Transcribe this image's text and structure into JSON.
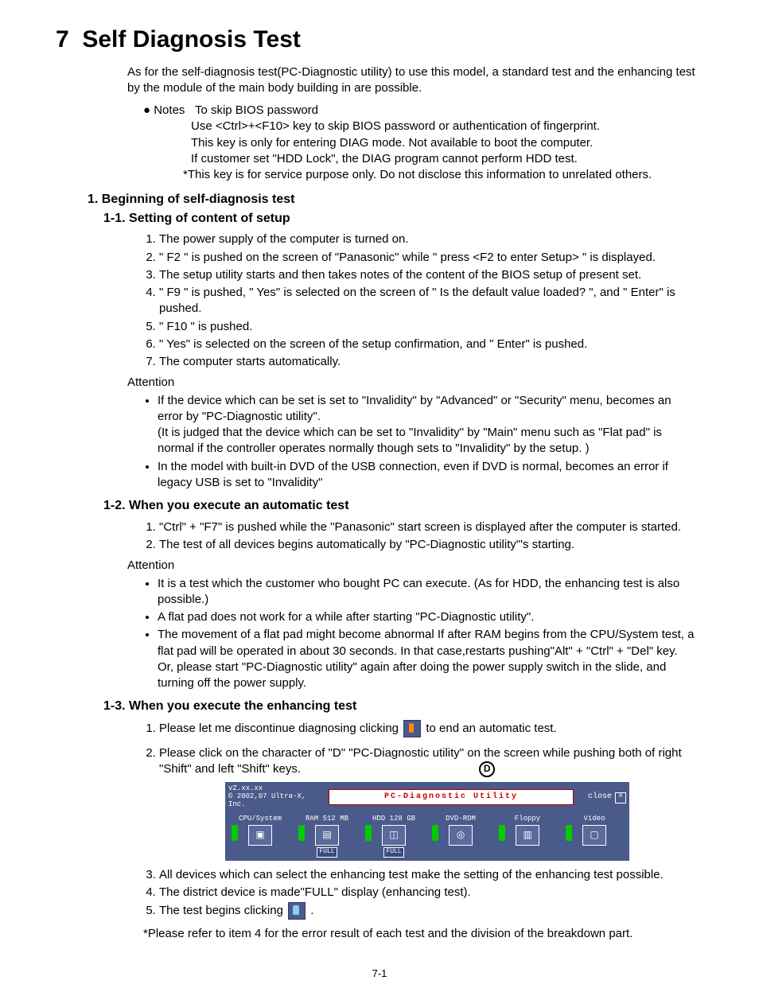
{
  "chapter_num": "7",
  "chapter_title": "Self Diagnosis Test",
  "intro": "As for the self-diagnosis test(PC-Diagnostic utility) to use this model, a standard test and the enhancing test by the module of the main body building in are possible.",
  "notes_label": "● Notes",
  "notes_title": "To skip BIOS password",
  "notes_lines": [
    "Use <Ctrl>+<F10> key to skip BIOS password or authentication of fingerprint.",
    "This key is only for entering DIAG mode. Not available to boot the computer.",
    "If customer set \"HDD Lock\",  the DIAG program cannot perform HDD test.",
    "*This key is for service purpose only. Do not disclose this information to unrelated others."
  ],
  "h_1": "1. Beginning of self-diagnosis test",
  "h_1_1": "1-1. Setting of content of setup",
  "steps_1_1": [
    "The power supply of the computer is turned on.",
    "\" F2 \" is pushed on the screen of  \"Panasonic\" while \" press <F2 to enter Setup> \" is displayed.",
    "The setup utility starts and then takes notes of the content of the BIOS setup of present set.",
    "\" F9 \" is pushed, \" Yes\" is selected on the screen of \" Is the default value loaded? \", and \" Enter\" is pushed.",
    "\" F10 \" is pushed.",
    "\" Yes\" is selected on the screen of the setup confirmation, and \" Enter\" is pushed.",
    "The computer starts automatically."
  ],
  "attention_label": "Attention",
  "attn_1_1": [
    "If the device which can be set is set to \"Invalidity\" by \"Advanced\" or \"Security\" menu, becomes an error by \"PC-Diagnostic utility\".\n(It is judged that the device which can be set to \"Invalidity\" by \"Main\" menu such as \"Flat pad\" is normal if the controller operates normally though sets to \"Invalidity\" by the setup. )",
    "In the model with built-in DVD of the USB connection, even if DVD is normal, becomes an error if legacy USB is set to \"Invalidity\""
  ],
  "h_1_2": "1-2. When you execute an automatic test",
  "steps_1_2": [
    "\"Ctrl\" + \"F7\" is pushed while the \"Panasonic\" start screen is displayed after the computer is started.",
    "The test of all devices begins automatically by \"PC-Diagnostic utility\"'s starting."
  ],
  "attn_1_2": [
    "It is a test which the customer who bought PC can execute. (As for HDD, the enhancing test is also possible.)",
    "A flat pad does not work for a while after starting \"PC-Diagnostic utility\".",
    "The movement of a flat pad might become abnormal If after RAM begins from the CPU/System test, a flat pad will be operated in about 30 seconds. In that case,restarts pushing\"Alt\" + \"Ctrl\" + \"Del\" key. Or, please start \"PC-Diagnostic utility\" again after doing the power supply switch in the slide, and turning off the power supply."
  ],
  "h_1_3": "1-3. When you execute the enhancing test",
  "step_1_3_1a": "Please let me discontinue diagnosing clicking",
  "step_1_3_1b": "to end an automatic test.",
  "step_1_3_2": "Please click on the character of \"D\" \"PC-Diagnostic utility\" on the screen while pushing both of right \"Shift\" and left \"Shift\" keys.",
  "d_marker": "D",
  "diag": {
    "version": "vZ.xx.xx",
    "copyright": "© 2002,07 Ultra-X, Inc.",
    "title": "PC-Diagnostic Utility",
    "close": "close",
    "items": [
      {
        "label": "CPU/System",
        "icon": "▣",
        "full": ""
      },
      {
        "label": "RAM 512 MB",
        "icon": "▤",
        "full": "FULL"
      },
      {
        "label": "HDD 128 GB",
        "icon": "◫",
        "full": "FULL"
      },
      {
        "label": "DVD-ROM",
        "icon": "◎",
        "full": ""
      },
      {
        "label": "Floppy",
        "icon": "▥",
        "full": ""
      },
      {
        "label": "Video",
        "icon": "▢",
        "full": ""
      }
    ]
  },
  "step_1_3_3": "All devices which can select the enhancing test make the setting of the enhancing test possible.",
  "step_1_3_4": "The district device is made\"FULL\" display (enhancing test).",
  "step_1_3_5a": "The test begins clicking",
  "step_1_3_5b": ".",
  "footnote": "*Please refer to item 4 for the error result of each test and the division of the breakdown part.",
  "pagenum": "7-1"
}
